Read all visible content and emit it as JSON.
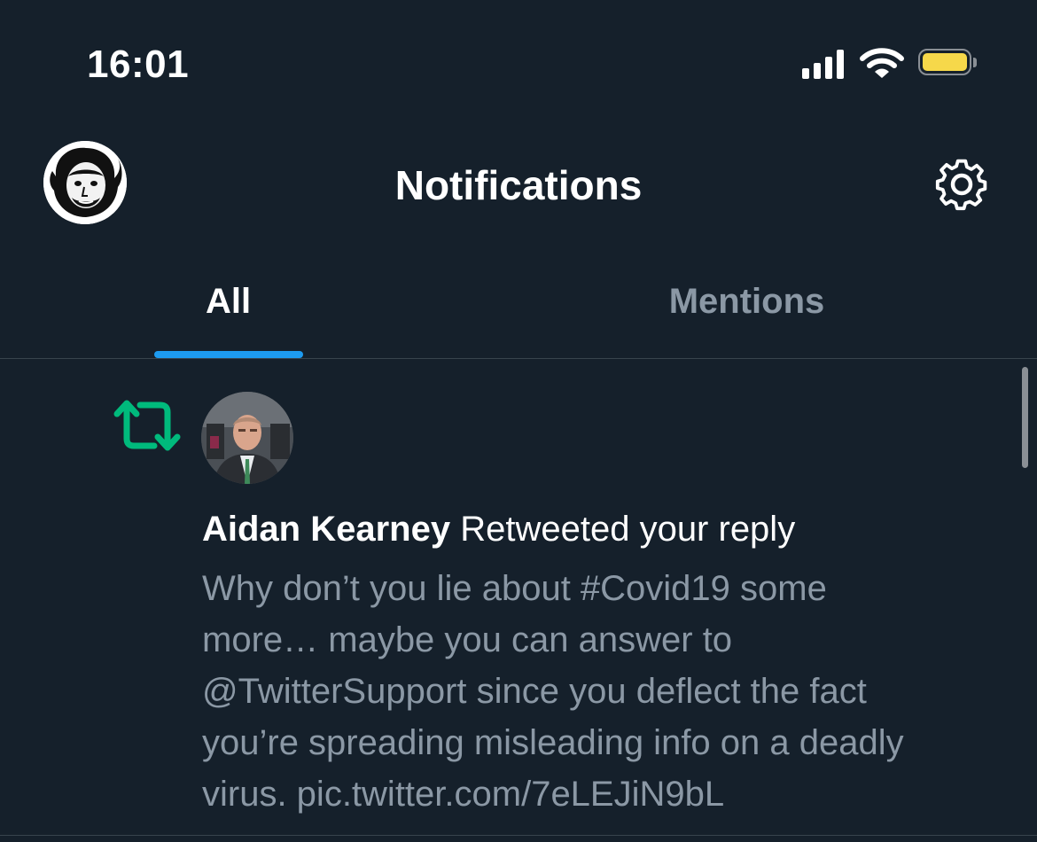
{
  "status_bar": {
    "time": "16:01",
    "icons": [
      "cellular-signal-icon",
      "wifi-icon",
      "battery-icon"
    ]
  },
  "header": {
    "title": "Notifications",
    "left_icon": "profile-avatar",
    "right_icon": "settings-gear-icon"
  },
  "tabs": [
    {
      "label": "All",
      "active": true
    },
    {
      "label": "Mentions",
      "active": false
    }
  ],
  "notification": {
    "icon": "retweet-icon",
    "user_name": "Aidan Kearney",
    "action_text": " Retweeted your reply",
    "tweet_lines": [
      "Why don’t you lie about #Covid19 some",
      "more… maybe you can answer to",
      "@TwitterSupport since you deflect the fact",
      "you’re spreading misleading info on a deadly",
      "virus. pic.twitter.com/7eLEJiN9bL"
    ]
  },
  "colors": {
    "background": "#15202b",
    "accent_blue": "#1d9bf0",
    "retweet_green": "#00ba7c",
    "secondary_text": "#8b98a5",
    "divider": "#38444d"
  }
}
